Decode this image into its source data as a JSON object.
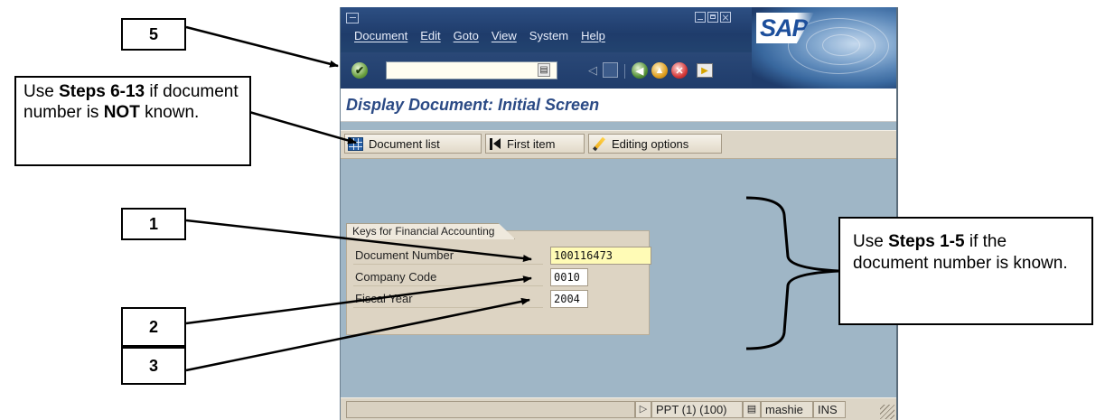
{
  "sap_window": {
    "menu": [
      "Document",
      "Edit",
      "Goto",
      "View",
      "System",
      "Help"
    ],
    "logo": "SAP",
    "command_field": "",
    "screen_title": "Display Document: Initial Screen",
    "app_toolbar": {
      "document_list": "Document list",
      "first_item": "First item",
      "editing_options": "Editing options"
    },
    "group": {
      "title": "Keys for Financial Accounting",
      "fields": [
        {
          "label": "Document Number",
          "value": "100116473"
        },
        {
          "label": "Company Code",
          "value": "0010"
        },
        {
          "label": "Fiscal Year",
          "value": "2004"
        }
      ]
    },
    "status_bar": {
      "message": "",
      "system": "PPT (1) (100)",
      "user": "mashie",
      "mode": "INS"
    }
  },
  "annotations": {
    "box_5": "5",
    "box_1": "1",
    "box_2": "2",
    "box_3": "3",
    "note_left": {
      "pre": "Use ",
      "bold1": "Steps 6-13",
      "mid": " if document number is ",
      "bold2": "NOT",
      "post": " known."
    },
    "note_right": {
      "pre": "Use ",
      "bold": "Steps 1-5",
      "post": " if the document number is known."
    }
  },
  "icons": [
    "enter-icon",
    "back-icon",
    "exit-icon",
    "cancel-icon",
    "print-icon",
    "document-list-icon",
    "first-item-icon",
    "pencil-icon"
  ]
}
